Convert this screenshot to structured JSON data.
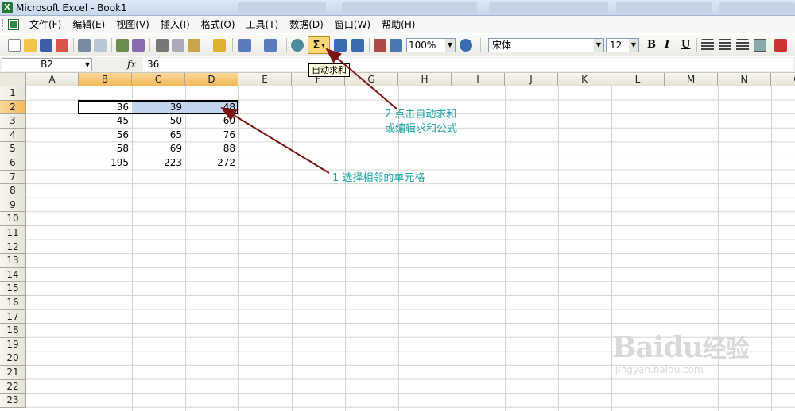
{
  "window": {
    "title": "Microsoft Excel - Book1",
    "app_icon": "X"
  },
  "menu": {
    "items": [
      "文件(F)",
      "编辑(E)",
      "视图(V)",
      "插入(I)",
      "格式(O)",
      "工具(T)",
      "数据(D)",
      "窗口(W)",
      "帮助(H)"
    ]
  },
  "toolbar": {
    "autosum_symbol": "Σ",
    "autosum_dropdown": "▾",
    "autosum_tooltip": "自动求和",
    "zoom": "100%",
    "font_name": "宋体",
    "font_size": "12",
    "bold": "B",
    "italic": "I",
    "underline": "U"
  },
  "formula_bar": {
    "cell_ref": "B2",
    "fx": "fx",
    "value": "36"
  },
  "sheet": {
    "columns": [
      "A",
      "B",
      "C",
      "D",
      "E",
      "F",
      "G",
      "H",
      "I",
      "J",
      "K",
      "L",
      "M",
      "N",
      "O"
    ],
    "rows": [
      "1",
      "2",
      "3",
      "4",
      "5",
      "6",
      "7",
      "8",
      "9",
      "10",
      "11",
      "12",
      "13",
      "14",
      "15",
      "16",
      "17",
      "18",
      "19",
      "20",
      "21",
      "22",
      "23"
    ],
    "data": {
      "row2": [
        "36",
        "39",
        "48"
      ],
      "row3": [
        "45",
        "50",
        "60"
      ],
      "row4": [
        "56",
        "65",
        "76"
      ],
      "row5": [
        "58",
        "69",
        "88"
      ],
      "row6": [
        "195",
        "223",
        "272"
      ]
    },
    "selected_range": "B2:D2",
    "selection_color": "#c3d5ee",
    "header_highlight": "#f5b75a"
  },
  "annotations": {
    "step2_line1": "2 点击自动求和",
    "step2_line2": "或编辑求和公式",
    "step1": "1  选择相邻的单元格",
    "arrow_color": "#7a1414",
    "text_color": "#1aa3a3"
  },
  "watermark": {
    "main": "Bai",
    "main2": "du",
    "main3": "经验",
    "sub": "jingyan.baidu.com"
  }
}
